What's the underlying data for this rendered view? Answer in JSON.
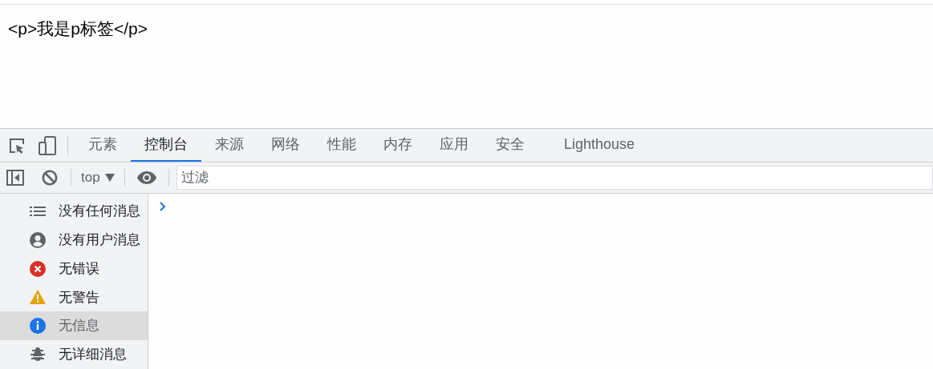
{
  "page": {
    "text": "<p>我是p标签</p>"
  },
  "tabs": [
    {
      "label": "元素",
      "selected": false
    },
    {
      "label": "控制台",
      "selected": true
    },
    {
      "label": "来源",
      "selected": false
    },
    {
      "label": "网络",
      "selected": false
    },
    {
      "label": "性能",
      "selected": false
    },
    {
      "label": "内存",
      "selected": false
    },
    {
      "label": "应用",
      "selected": false
    },
    {
      "label": "安全",
      "selected": false
    },
    {
      "label": "Lighthouse",
      "selected": false
    }
  ],
  "toolbar": {
    "context": "top",
    "filter_placeholder": "过滤"
  },
  "sidebar": {
    "items": [
      {
        "kind": "list",
        "label": "没有任何消息",
        "selected": false
      },
      {
        "kind": "user",
        "label": "没有用户消息",
        "selected": false
      },
      {
        "kind": "error",
        "label": "无错误",
        "selected": false
      },
      {
        "kind": "warning",
        "label": "无警告",
        "selected": false
      },
      {
        "kind": "info",
        "label": "无信息",
        "selected": true
      },
      {
        "kind": "verbose",
        "label": "无详细消息",
        "selected": false
      }
    ]
  }
}
